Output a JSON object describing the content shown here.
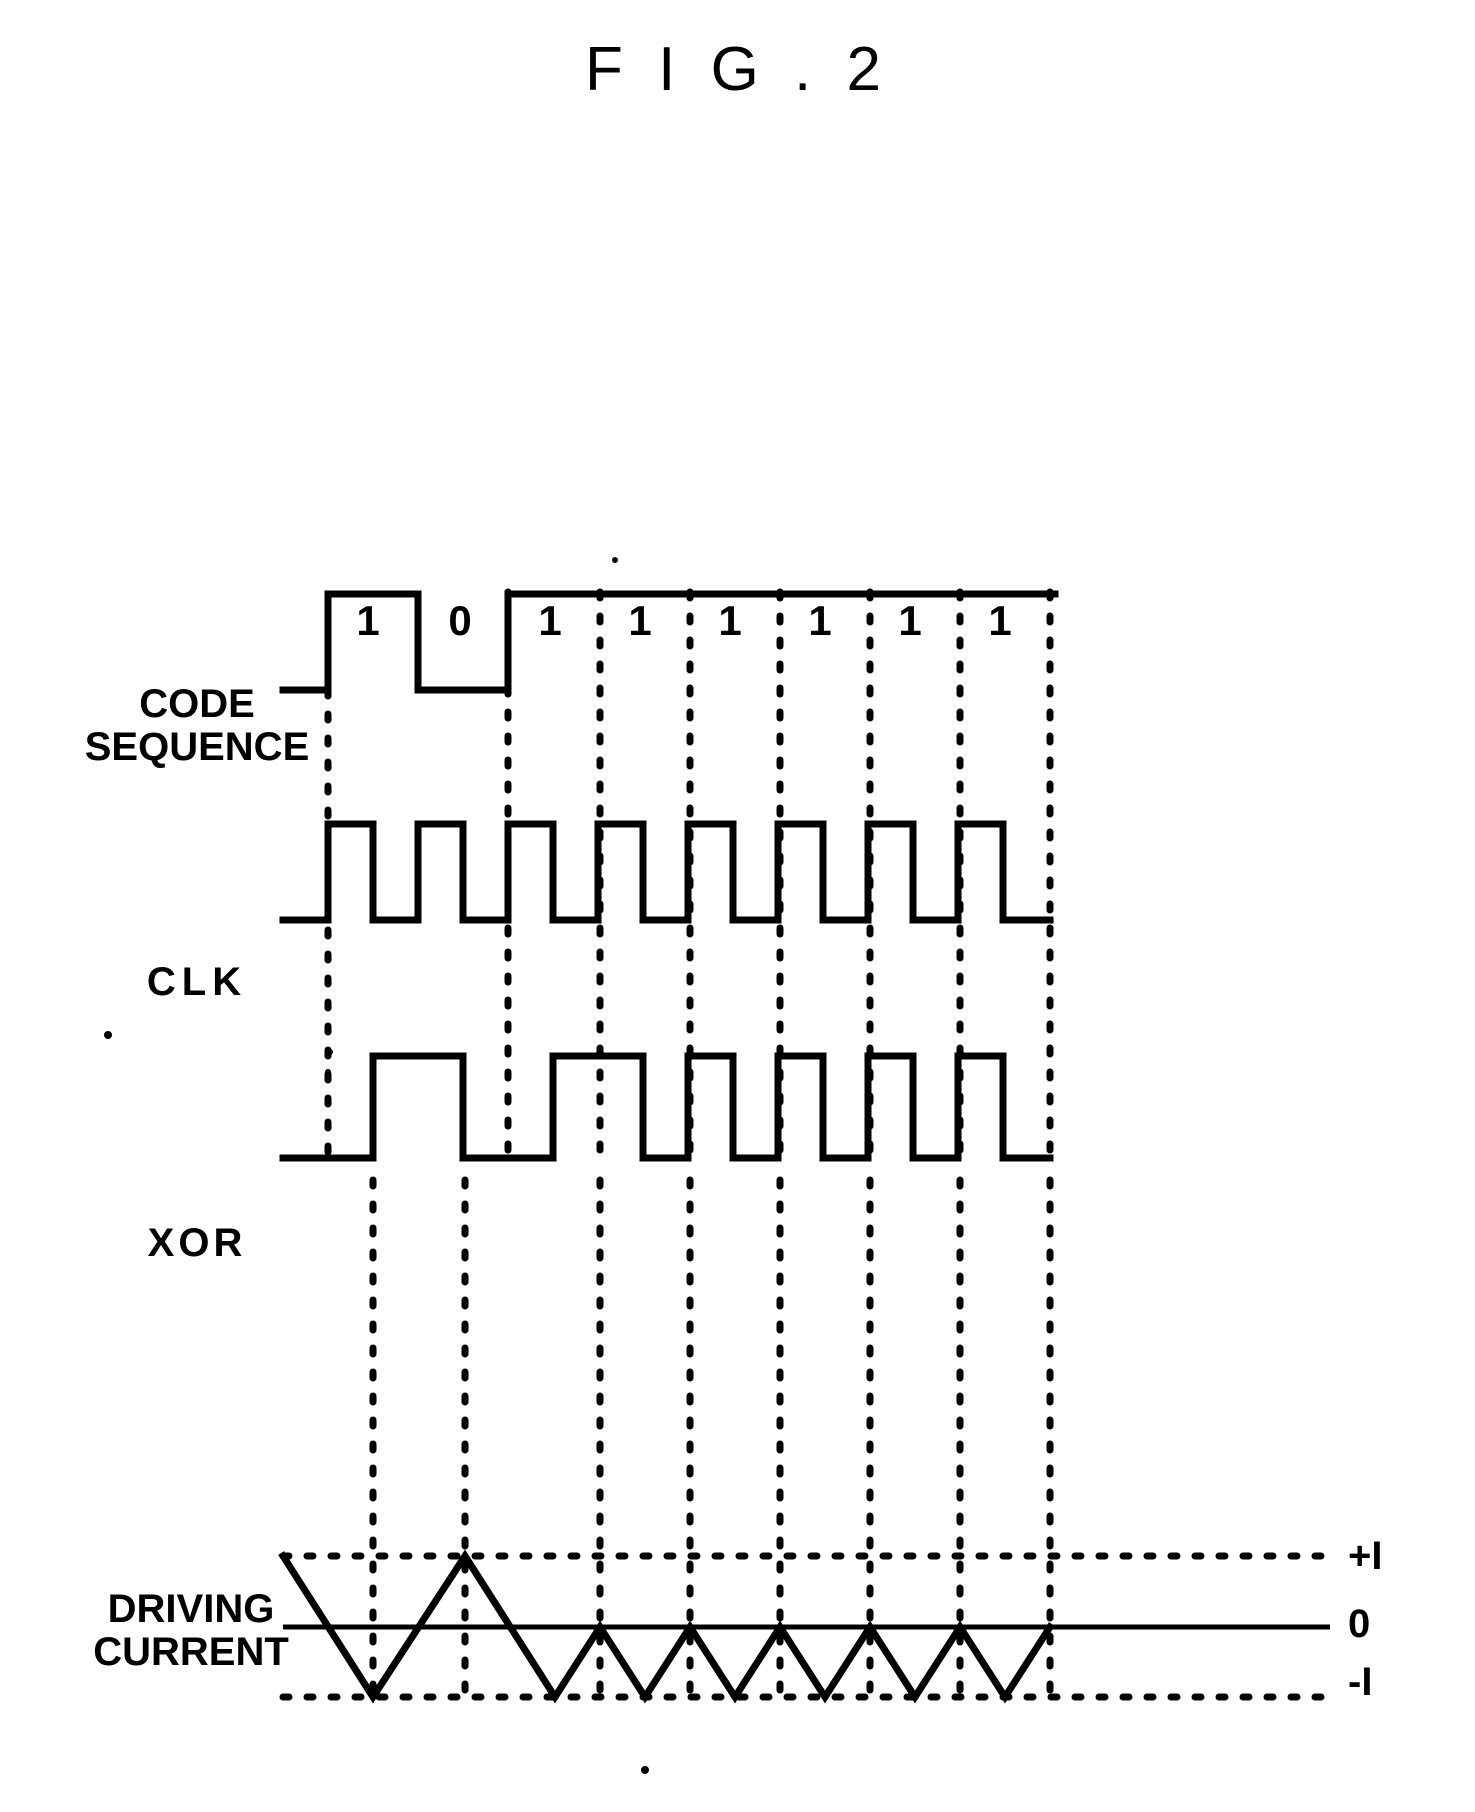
{
  "figure": {
    "title": "F I G . 2",
    "type": "timing-diagram"
  },
  "signals": {
    "code_sequence_label": "CODE\nSEQUENCE",
    "clk_label": "CLK",
    "xor_label": "XOR",
    "driving_current_label": "DRIVING\nCURRENT"
  },
  "bit_labels": [
    "1",
    "0",
    "1",
    "1",
    "1",
    "1",
    "1",
    "1"
  ],
  "current_axis": {
    "top": "+I",
    "middle": "0",
    "bottom": "-I"
  },
  "chart_data": {
    "type": "line",
    "title": "F I G . 2",
    "xlabel": "",
    "ylabel": "",
    "categories": [
      "1",
      "0",
      "1",
      "1",
      "1",
      "1",
      "1",
      "1"
    ],
    "series": [
      {
        "name": "CODE SEQUENCE",
        "values": [
          1,
          0,
          1,
          1,
          1,
          1,
          1,
          1
        ],
        "levels": [
          "low",
          "high",
          "low",
          "high",
          "high",
          "high",
          "high",
          "high",
          "high"
        ]
      },
      {
        "name": "CLK",
        "values": [
          1,
          1,
          1,
          1,
          1,
          1,
          1,
          1
        ],
        "description": "square wave, one pulse per bit period"
      },
      {
        "name": "XOR",
        "values": [
          1,
          0,
          1,
          1,
          1,
          1,
          1,
          1
        ],
        "description": "exclusive-or of code sequence and clock"
      },
      {
        "name": "DRIVING CURRENT",
        "values": [
          1,
          -1,
          1,
          -1,
          1,
          -1,
          1,
          -1
        ],
        "description": "triangular wave swinging between +I and -I",
        "ylim": [
          -1,
          1
        ]
      }
    ],
    "grid": "dotted vertical bit boundaries; dotted horizontal +I and -I rails",
    "legend": "none"
  }
}
